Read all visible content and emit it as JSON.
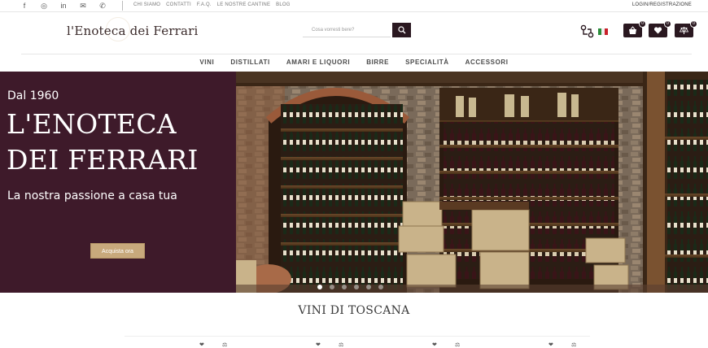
{
  "topbar": {
    "social_icons": [
      "facebook-icon",
      "instagram-icon",
      "linkedin-icon",
      "mail-icon",
      "whatsapp-icon"
    ],
    "links": [
      "CHI SIAMO",
      "CONTATTI",
      "F.A.Q.",
      "LE NOSTRE CANTINE",
      "BLOG"
    ],
    "login": "LOGIN/REGISTRAZIONE"
  },
  "header": {
    "logo": "l'Enoteca dei Ferrari",
    "search_placeholder": "Cosa vorresti bere?",
    "cart_counts": [
      "0",
      "0",
      "0"
    ],
    "flag": "it-flag"
  },
  "nav": {
    "items": [
      "VINI",
      "DISTILLATI",
      "AMARI E LIQUORI",
      "BIRRE",
      "SPECIALITÀ",
      "ACCESSORI"
    ]
  },
  "hero": {
    "since": "Dal 1960",
    "title": "L'ENOTECA DEI FERRARI",
    "subtitle": "La nostra passione a casa tua",
    "cta": "Acquista ora",
    "slides_total": 6,
    "slide_active": 1
  },
  "section": {
    "title": "VINI DI TOSCANA"
  },
  "colors": {
    "accent": "#3e1a2a",
    "button": "#2a1820",
    "cta": "#c8a97c"
  }
}
